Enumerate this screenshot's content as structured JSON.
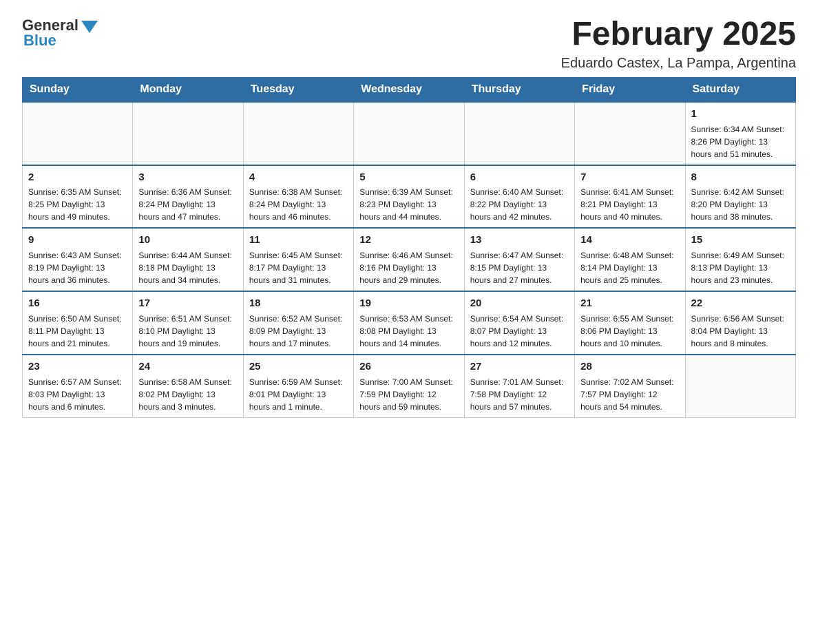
{
  "logo": {
    "general": "General",
    "blue": "Blue"
  },
  "header": {
    "month": "February 2025",
    "location": "Eduardo Castex, La Pampa, Argentina"
  },
  "weekdays": [
    "Sunday",
    "Monday",
    "Tuesday",
    "Wednesday",
    "Thursday",
    "Friday",
    "Saturday"
  ],
  "weeks": [
    [
      {
        "day": "",
        "info": ""
      },
      {
        "day": "",
        "info": ""
      },
      {
        "day": "",
        "info": ""
      },
      {
        "day": "",
        "info": ""
      },
      {
        "day": "",
        "info": ""
      },
      {
        "day": "",
        "info": ""
      },
      {
        "day": "1",
        "info": "Sunrise: 6:34 AM\nSunset: 8:26 PM\nDaylight: 13 hours and 51 minutes."
      }
    ],
    [
      {
        "day": "2",
        "info": "Sunrise: 6:35 AM\nSunset: 8:25 PM\nDaylight: 13 hours and 49 minutes."
      },
      {
        "day": "3",
        "info": "Sunrise: 6:36 AM\nSunset: 8:24 PM\nDaylight: 13 hours and 47 minutes."
      },
      {
        "day": "4",
        "info": "Sunrise: 6:38 AM\nSunset: 8:24 PM\nDaylight: 13 hours and 46 minutes."
      },
      {
        "day": "5",
        "info": "Sunrise: 6:39 AM\nSunset: 8:23 PM\nDaylight: 13 hours and 44 minutes."
      },
      {
        "day": "6",
        "info": "Sunrise: 6:40 AM\nSunset: 8:22 PM\nDaylight: 13 hours and 42 minutes."
      },
      {
        "day": "7",
        "info": "Sunrise: 6:41 AM\nSunset: 8:21 PM\nDaylight: 13 hours and 40 minutes."
      },
      {
        "day": "8",
        "info": "Sunrise: 6:42 AM\nSunset: 8:20 PM\nDaylight: 13 hours and 38 minutes."
      }
    ],
    [
      {
        "day": "9",
        "info": "Sunrise: 6:43 AM\nSunset: 8:19 PM\nDaylight: 13 hours and 36 minutes."
      },
      {
        "day": "10",
        "info": "Sunrise: 6:44 AM\nSunset: 8:18 PM\nDaylight: 13 hours and 34 minutes."
      },
      {
        "day": "11",
        "info": "Sunrise: 6:45 AM\nSunset: 8:17 PM\nDaylight: 13 hours and 31 minutes."
      },
      {
        "day": "12",
        "info": "Sunrise: 6:46 AM\nSunset: 8:16 PM\nDaylight: 13 hours and 29 minutes."
      },
      {
        "day": "13",
        "info": "Sunrise: 6:47 AM\nSunset: 8:15 PM\nDaylight: 13 hours and 27 minutes."
      },
      {
        "day": "14",
        "info": "Sunrise: 6:48 AM\nSunset: 8:14 PM\nDaylight: 13 hours and 25 minutes."
      },
      {
        "day": "15",
        "info": "Sunrise: 6:49 AM\nSunset: 8:13 PM\nDaylight: 13 hours and 23 minutes."
      }
    ],
    [
      {
        "day": "16",
        "info": "Sunrise: 6:50 AM\nSunset: 8:11 PM\nDaylight: 13 hours and 21 minutes."
      },
      {
        "day": "17",
        "info": "Sunrise: 6:51 AM\nSunset: 8:10 PM\nDaylight: 13 hours and 19 minutes."
      },
      {
        "day": "18",
        "info": "Sunrise: 6:52 AM\nSunset: 8:09 PM\nDaylight: 13 hours and 17 minutes."
      },
      {
        "day": "19",
        "info": "Sunrise: 6:53 AM\nSunset: 8:08 PM\nDaylight: 13 hours and 14 minutes."
      },
      {
        "day": "20",
        "info": "Sunrise: 6:54 AM\nSunset: 8:07 PM\nDaylight: 13 hours and 12 minutes."
      },
      {
        "day": "21",
        "info": "Sunrise: 6:55 AM\nSunset: 8:06 PM\nDaylight: 13 hours and 10 minutes."
      },
      {
        "day": "22",
        "info": "Sunrise: 6:56 AM\nSunset: 8:04 PM\nDaylight: 13 hours and 8 minutes."
      }
    ],
    [
      {
        "day": "23",
        "info": "Sunrise: 6:57 AM\nSunset: 8:03 PM\nDaylight: 13 hours and 6 minutes."
      },
      {
        "day": "24",
        "info": "Sunrise: 6:58 AM\nSunset: 8:02 PM\nDaylight: 13 hours and 3 minutes."
      },
      {
        "day": "25",
        "info": "Sunrise: 6:59 AM\nSunset: 8:01 PM\nDaylight: 13 hours and 1 minute."
      },
      {
        "day": "26",
        "info": "Sunrise: 7:00 AM\nSunset: 7:59 PM\nDaylight: 12 hours and 59 minutes."
      },
      {
        "day": "27",
        "info": "Sunrise: 7:01 AM\nSunset: 7:58 PM\nDaylight: 12 hours and 57 minutes."
      },
      {
        "day": "28",
        "info": "Sunrise: 7:02 AM\nSunset: 7:57 PM\nDaylight: 12 hours and 54 minutes."
      },
      {
        "day": "",
        "info": ""
      }
    ]
  ]
}
